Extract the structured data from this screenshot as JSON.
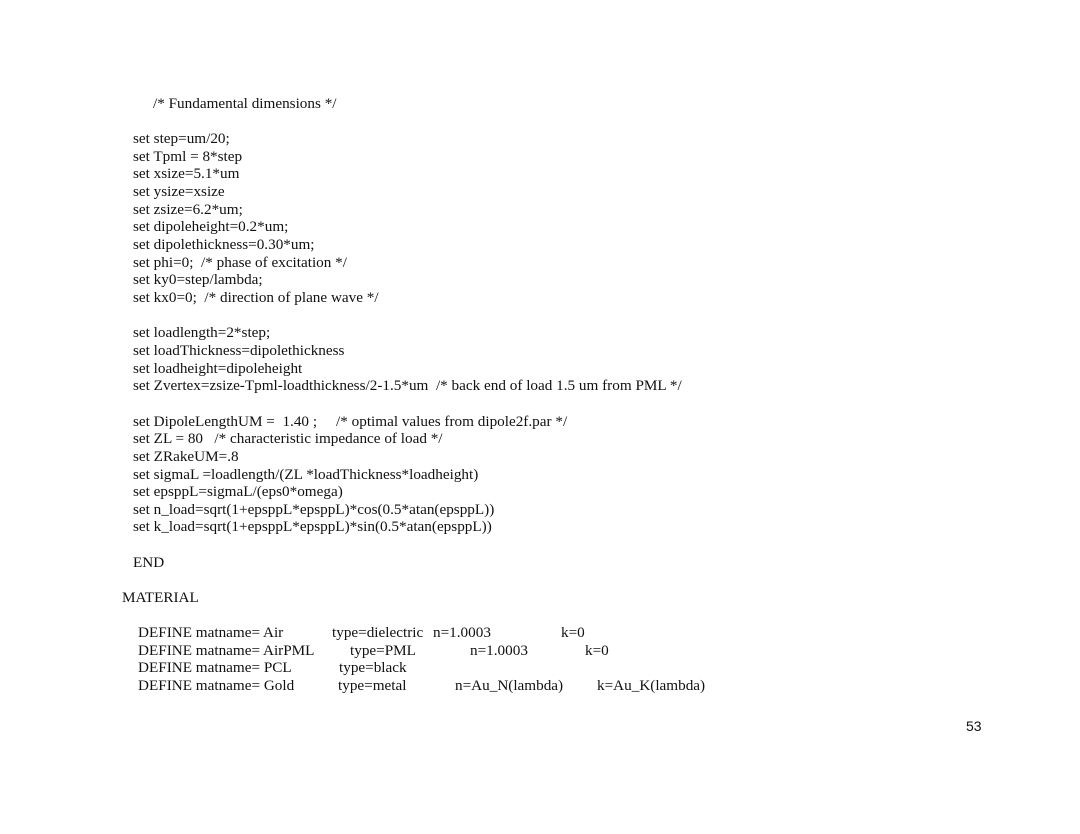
{
  "document": {
    "comment_header": "/* Fundamental dimensions */",
    "dimension_lines": [
      "set step=um/20;",
      "set Tpml = 8*step",
      "set xsize=5.1*um",
      "set ysize=xsize",
      "set zsize=6.2*um;",
      "set dipoleheight=0.2*um;",
      "set dipolethickness=0.30*um;",
      "set phi=0;  /* phase of excitation */",
      "set ky0=step/lambda;",
      "set kx0=0;  /* direction of plane wave */"
    ],
    "load_lines": [
      "set loadlength=2*step;",
      "set loadThickness=dipolethickness",
      "set loadheight=dipoleheight",
      "set Zvertex=zsize-Tpml-loadthickness/2-1.5*um  /* back end of load 1.5 um from PML */"
    ],
    "param_lines": [
      "set DipoleLengthUM =  1.40 ;     /* optimal values from dipole2f.par */",
      "set ZL = 80   /* characteristic impedance of load */",
      "set ZRakeUM=.8",
      "set sigmaL =loadlength/(ZL *loadThickness*loadheight)",
      "set epsppL=sigmaL/(eps0*omega)",
      "set n_load=sqrt(1+epsppL*epsppL)*cos(0.5*atan(epsppL))",
      "set k_load=sqrt(1+epsppL*epsppL)*sin(0.5*atan(epsppL))"
    ],
    "end_keyword": "END",
    "material_keyword": "MATERIAL",
    "materials": [
      {
        "define": "DEFINE matname= Air",
        "type": "type=dielectric",
        "n": "n=1.0003",
        "k": "k=0"
      },
      {
        "define": "DEFINE matname= AirPML",
        "type": "type=PML",
        "n": "n=1.0003",
        "k": "k=0"
      },
      {
        "define": "DEFINE matname= PCL",
        "type": "type=black",
        "n": "",
        "k": ""
      },
      {
        "define": "DEFINE matname= Gold",
        "type": "type=metal",
        "n": "n=Au_N(lambda)",
        "k": "k=Au_K(lambda)"
      }
    ],
    "page_number": "53"
  }
}
